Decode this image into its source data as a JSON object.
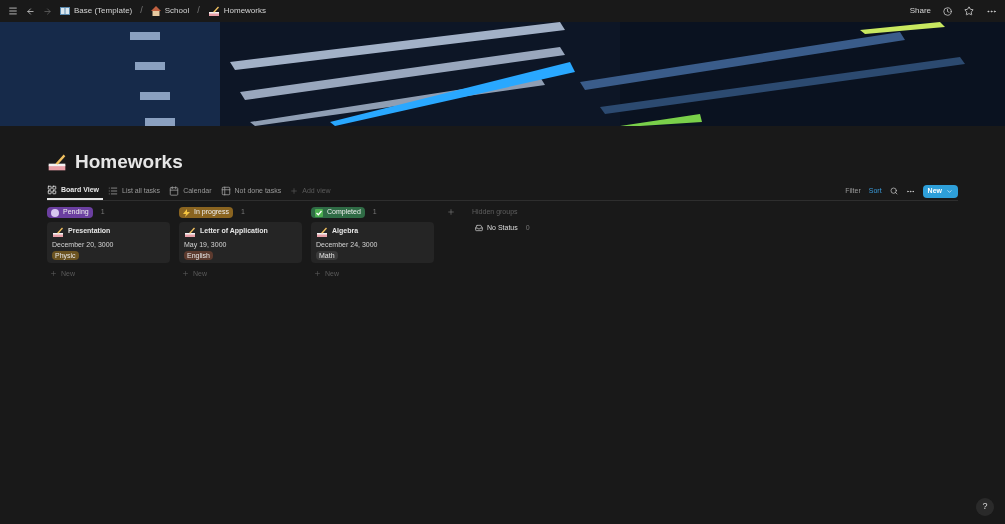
{
  "topbar": {
    "breadcrumbs": [
      {
        "label": "Base (Template)"
      },
      {
        "separator": "/",
        "label": "School"
      },
      {
        "separator": "/",
        "label": "Homeworks"
      }
    ],
    "share": "Share"
  },
  "page": {
    "title": "Homeworks"
  },
  "views": [
    {
      "label": "Board View",
      "selected": true
    },
    {
      "label": "List all tasks",
      "selected": false
    },
    {
      "label": "Calendar",
      "selected": false
    },
    {
      "label": "Not done tasks",
      "selected": false
    }
  ],
  "add_view": "Add view",
  "toolbar": {
    "filter": "Filter",
    "sort": "Sort",
    "new": "New"
  },
  "groups": [
    {
      "label": "Pending",
      "color": "#6b3fa0",
      "count": "1",
      "cards": [
        {
          "title": "Presentation",
          "date": "December 20, 3000",
          "tag": {
            "label": "Physic",
            "color": "#6b5320"
          }
        }
      ],
      "new": "New"
    },
    {
      "label": "In progress",
      "color": "#8a6420",
      "count": "1",
      "cards": [
        {
          "title": "Letter of Application",
          "date": "May 19, 3000",
          "tag": {
            "label": "English",
            "color": "#5c3a2e"
          }
        }
      ],
      "new": "New"
    },
    {
      "label": "Completed",
      "color": "#2f6b45",
      "count": "1",
      "cards": [
        {
          "title": "Algebra",
          "date": "December 24, 3000",
          "tag": {
            "label": "Math",
            "color": "#3a3a3a"
          }
        }
      ],
      "new": "New"
    }
  ],
  "hidden_groups": {
    "label": "Hidden groups",
    "items": [
      {
        "label": "No Status",
        "count": "0"
      }
    ]
  },
  "help": "?"
}
